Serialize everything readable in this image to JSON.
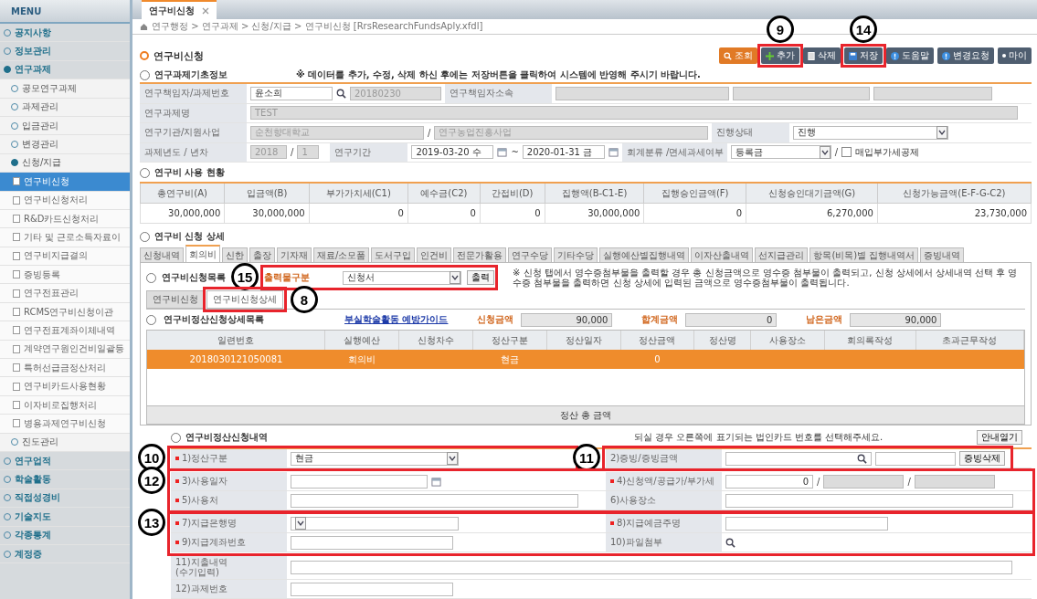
{
  "open_tabs": [
    {
      "label": "연구비신청",
      "selected": true
    }
  ],
  "breadcrumb": "연구행정 > 연구과제 > 신청/지급 > 연구비신청 [RrsResearchFundsAply.xfdl]",
  "sidebar": {
    "title": "MENU",
    "items": [
      {
        "label": "공지사항",
        "expanded": false
      },
      {
        "label": "정보관리",
        "expanded": false
      },
      {
        "label": "연구과제",
        "expanded": true,
        "children": [
          {
            "label": "공모연구과제",
            "expanded": false
          },
          {
            "label": "과제관리",
            "expanded": false
          },
          {
            "label": "입금관리",
            "expanded": false
          },
          {
            "label": "변경관리",
            "expanded": false
          },
          {
            "label": "신청/지급",
            "expanded": true,
            "children": [
              {
                "label": "연구비신청",
                "selected": true
              },
              {
                "label": "연구비신청처리",
                "selected": false
              },
              {
                "label": "R&D카드신청처리",
                "selected": false
              },
              {
                "label": "기타 및 근로소득자료이",
                "selected": false
              },
              {
                "label": "연구비지급결의",
                "selected": false
              },
              {
                "label": "증빙등록",
                "selected": false
              },
              {
                "label": "연구전표관리",
                "selected": false
              },
              {
                "label": "RCMS연구비신청이관",
                "selected": false
              },
              {
                "label": "연구전표계좌이체내역",
                "selected": false
              },
              {
                "label": "계약연구원인건비일괄등",
                "selected": false
              },
              {
                "label": "특허선급금정산처리",
                "selected": false
              },
              {
                "label": "연구비카드사용현황",
                "selected": false
              },
              {
                "label": "이자비로집행처리",
                "selected": false
              },
              {
                "label": "병용과제연구비신청",
                "selected": false
              }
            ]
          },
          {
            "label": "진도관리",
            "expanded": false
          }
        ]
      },
      {
        "label": "연구업적",
        "expanded": false
      },
      {
        "label": "학술활동",
        "expanded": false
      },
      {
        "label": "직접성경비",
        "expanded": false
      },
      {
        "label": "기술지도",
        "expanded": false
      },
      {
        "label": "각종통계",
        "expanded": false
      },
      {
        "label": "계정증",
        "expanded": false
      }
    ]
  },
  "page_title": "연구비신청",
  "toolbar": [
    {
      "label": "조회",
      "kind": "search"
    },
    {
      "label": "추가",
      "kind": "add"
    },
    {
      "label": "삭제",
      "kind": "delete"
    },
    {
      "label": "저장",
      "kind": "save"
    },
    {
      "label": "도움말",
      "kind": "help"
    },
    {
      "label": "변경요청",
      "kind": "help"
    },
    {
      "label": "마이",
      "kind": "more"
    }
  ],
  "basic_info": {
    "title": "연구과제기초정보",
    "notice": "※ 데이터를 추가, 수정, 삭제 하신 후에는 저장버튼을 클릭하여 시스템에 반영해 주시기 바랍니다.",
    "researcher_label": "연구책임자/과제번호",
    "researcher": "윤소희",
    "project_no": "20180230",
    "affiliation_label": "연구책임자소속",
    "project_name_label": "연구과제명",
    "project_name": "TEST",
    "institution_label": "연구기관/지원사업",
    "institution": "순천향대학교",
    "institution_sep": "/",
    "program": "연구농업진흥사업",
    "status_label": "진행상태",
    "status": "진행",
    "year_label": "과제년도 / 년차",
    "year": "2018",
    "year_sep": "/",
    "term": "1",
    "period_label": "연구기간",
    "start": "2019-03-20 수",
    "period_sep": "~",
    "end": "2020-01-31 금",
    "accounting_label": "회계분류 /면세과세여부",
    "accounting": "등록금",
    "accounting_sep": "/",
    "vat_label": "매입부가세공제",
    "vat_checked": false
  },
  "usage": {
    "title": "연구비 사용 현황",
    "columns": [
      "총연구비(A)",
      "입금액(B)",
      "부가가치세(C1)",
      "예수금(C2)",
      "간접비(D)",
      "집행액(B-C1-E)",
      "집행승인금액(F)",
      "신청승인대기금액(G)",
      "신청가능금액(E-F-G-C2)"
    ],
    "values": [
      "30,000,000",
      "30,000,000",
      "0",
      "0",
      "0",
      "30,000,000",
      "0",
      "6,270,000",
      "23,730,000"
    ]
  },
  "detail": {
    "title": "연구비 신청 상세",
    "tabs": [
      {
        "label": "신청내역",
        "selected": false
      },
      {
        "label": "회의비",
        "selected": true
      },
      {
        "label": "신한",
        "selected": false
      },
      {
        "label": "출장",
        "selected": false
      },
      {
        "label": "기자재",
        "selected": false
      },
      {
        "label": "재료/소모품",
        "selected": false
      },
      {
        "label": "도서구입",
        "selected": false
      },
      {
        "label": "인건비",
        "selected": false
      },
      {
        "label": "전문가활용",
        "selected": false
      },
      {
        "label": "연구수당",
        "selected": false
      },
      {
        "label": "기타수당",
        "selected": false
      },
      {
        "label": "실행예산별집행내역",
        "selected": false
      },
      {
        "label": "이자산출내역",
        "selected": false
      },
      {
        "label": "선지급관리",
        "selected": false
      },
      {
        "label": "항목(비목)별 집행내역서",
        "selected": false
      },
      {
        "label": "증빙내역",
        "selected": false
      }
    ],
    "panel_title": "연구비신청목록",
    "print_label": "출력물구분",
    "print_value": "신청서",
    "print_button": "출력",
    "print_notice": "※ 신청 탭에서 영수증첨부물을 출력할 경우 총 신청금액으로 영수증 첨부물이 출력되고, 신청 상세에서 상세내역 선택 후 영수증 첨부물을 출력하면 신청 상세에 입력된 금액으로 영수증첨부물이 출력됩니다.",
    "subtabs": [
      {
        "label": "연구비신청",
        "selected": false
      },
      {
        "label": "연구비신청상세",
        "selected": true
      }
    ],
    "list_title": "연구비정산신청상세목록",
    "guide_link": "부실학술활동 예방가이드",
    "amounts": [
      {
        "label": "신청금액",
        "value": "90,000"
      },
      {
        "label": "합계금액",
        "value": "0"
      },
      {
        "label": "남은금액",
        "value": "90,000"
      }
    ],
    "grid_columns": [
      "일련번호",
      "실행예산",
      "신청차수",
      "정산구분",
      "정산일자",
      "정산금액",
      "정산명",
      "사용장소",
      "회의록작성",
      "초과근무작성"
    ],
    "grid_rows": [
      {
        "selected": true,
        "cells": [
          "2018030121050081",
          "회의비",
          "",
          "현금",
          "",
          "0",
          "",
          "",
          "",
          ""
        ]
      }
    ],
    "grid_footer": "정산 총 금액"
  },
  "settlement": {
    "title": "연구비정산신청내역",
    "hint": "되실 경우 오른쪽에 표기되는 법인카드 번호를 선택해주세요.",
    "guide_button": "안내열기",
    "rows": [
      [
        {
          "label": "1)정산구분",
          "required": true,
          "kind": "select",
          "value": "현금"
        },
        {
          "label": "2)증빙/증빙금액",
          "required": false,
          "kind": "evidence",
          "button": "증빙삭제"
        }
      ],
      [
        {
          "label": "3)사용일자",
          "required": true,
          "kind": "date"
        },
        {
          "label": "4)신청액/공급가/부가세",
          "required": true,
          "kind": "amounts",
          "value": "0",
          "sep": "/"
        }
      ],
      [
        {
          "label": "5)사용처",
          "required": true,
          "kind": "text"
        },
        {
          "label": "6)사용장소",
          "required": false,
          "kind": "text"
        }
      ],
      [
        {
          "label": "7)지급은행명",
          "required": true,
          "kind": "select"
        },
        {
          "label": "8)지급예금주명",
          "required": true,
          "kind": "short"
        }
      ],
      [
        {
          "label": "9)지급계좌번호",
          "required": true,
          "kind": "short"
        },
        {
          "label": "10)파일첨부",
          "required": false,
          "kind": "attach"
        }
      ],
      [
        {
          "label": "11)지출내역\n(수기입력)",
          "required": false,
          "kind": "wide"
        }
      ],
      [
        {
          "label": "12)과제번호",
          "required": false,
          "kind": "short"
        }
      ]
    ]
  },
  "annotations": [
    {
      "number": "9"
    },
    {
      "number": "14"
    },
    {
      "number": "15"
    },
    {
      "number": "8"
    },
    {
      "number": "10"
    },
    {
      "number": "11"
    },
    {
      "number": "12"
    },
    {
      "number": "13"
    }
  ]
}
